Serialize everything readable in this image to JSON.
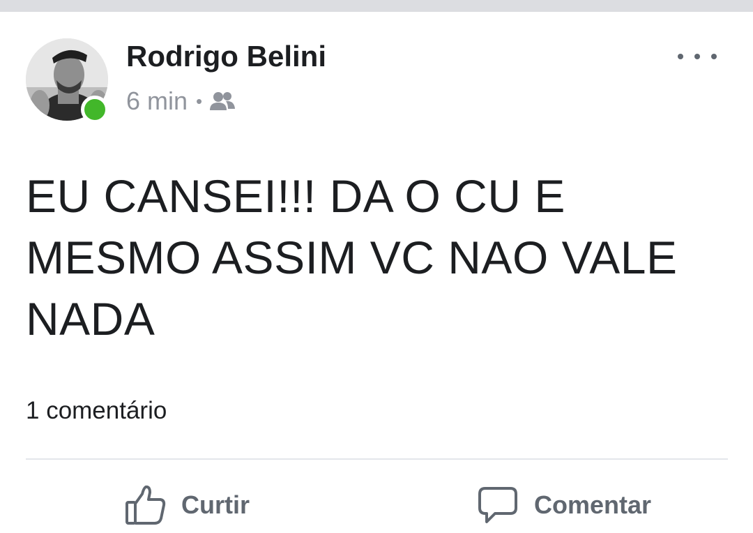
{
  "post": {
    "author": {
      "name": "Rodrigo Belini",
      "online": true
    },
    "meta": {
      "time": "6 min",
      "separator": "•",
      "audience_icon": "friends-icon"
    },
    "menu_icon": "more-horizontal-icon",
    "text": "EU CANSEI!!! DA O CU E\nMESMO ASSIM VC NAO VALE\nNADA",
    "comment_count_label": "1 comentário",
    "actions": {
      "like": {
        "label": "Curtir",
        "icon": "thumbs-up-icon"
      },
      "comment": {
        "label": "Comentar",
        "icon": "speech-bubble-icon"
      }
    }
  },
  "colors": {
    "name": "#1c1e21",
    "meta": "#90949c",
    "action": "#606770",
    "online": "#42b72a",
    "divider": "#e4e6eb",
    "top_strip": "#dcdde1"
  }
}
